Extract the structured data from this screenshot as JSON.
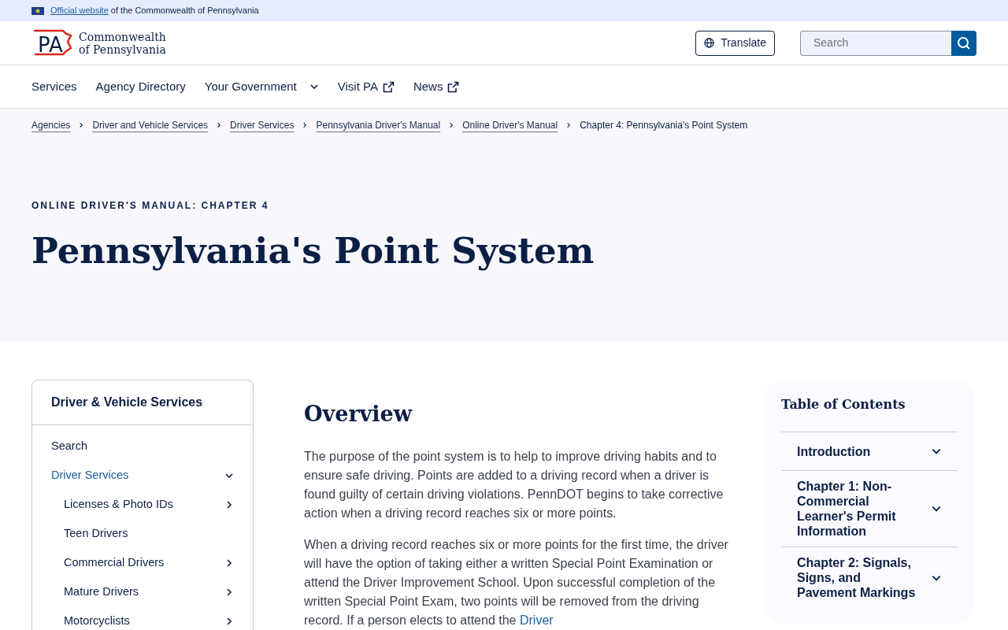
{
  "official_banner": {
    "link": "Official website",
    "text": "of the Commonwealth of Pennsylvania"
  },
  "header": {
    "logo": {
      "mark": "PA",
      "line1": "Commonwealth",
      "line2": "of Pennsylvania"
    },
    "translate_button": "Translate",
    "search": {
      "placeholder": "Search"
    }
  },
  "nav": [
    {
      "label": "Services",
      "kind": "plain"
    },
    {
      "label": "Agency Directory",
      "kind": "plain"
    },
    {
      "label": "Your Government",
      "kind": "dropdown"
    },
    {
      "label": "Visit PA",
      "kind": "external"
    },
    {
      "label": "News",
      "kind": "external"
    }
  ],
  "breadcrumbs": [
    {
      "label": "Agencies",
      "current": false
    },
    {
      "label": "Driver and Vehicle Services",
      "current": false
    },
    {
      "label": "Driver Services",
      "current": false
    },
    {
      "label": "Pennsylvania Driver's Manual",
      "current": false
    },
    {
      "label": "Online Driver's Manual",
      "current": false
    },
    {
      "label": "Chapter 4: Pennsylvania's Point System",
      "current": true
    }
  ],
  "hero": {
    "eyebrow": "ONLINE DRIVER'S MANUAL: CHAPTER 4",
    "title": "Pennsylvania's Point System"
  },
  "sidebar": {
    "title": "Driver & Vehicle Services",
    "items": [
      {
        "label": "Search",
        "selected": false
      },
      {
        "label": "Driver Services",
        "selected": true,
        "expanded": true,
        "children": [
          {
            "label": "Licenses & Photo IDs",
            "selected": false,
            "expanded": false
          },
          {
            "label": "Teen Drivers",
            "selected": false
          },
          {
            "label": "Commercial Drivers",
            "selected": false,
            "expanded": false
          },
          {
            "label": "Mature Drivers",
            "selected": false,
            "expanded": false
          },
          {
            "label": "Motorcyclists",
            "selected": false,
            "expanded": false
          }
        ]
      }
    ]
  },
  "article": {
    "heading": "Overview",
    "paragraphs": [
      {
        "text": "The purpose of the point system is to help to improve driving habits and to ensure safe driving. Points are added to a driving record when a driver is found guilty of certain driving violations. PennDOT begins to take corrective action when a driving record reaches six or more points."
      },
      {
        "text": "When a driving record reaches six or more points for the first time, the driver will have the option of taking either a written Special Point Examination or attend the Driver Improvement School.  Upon successful completion of the written Special Point Exam, two points will be removed from the driving record.  If a person elects to attend the ",
        "link": "Driver"
      }
    ]
  },
  "toc": {
    "title": "Table of Contents",
    "items": [
      {
        "label": "Introduction",
        "expanded": false
      },
      {
        "label": "Chapter 1: Non-Commercial Learner's Permit Information",
        "expanded": false
      },
      {
        "label": "Chapter 2: Signals, Signs, and Pavement Markings",
        "expanded": false
      }
    ]
  }
}
